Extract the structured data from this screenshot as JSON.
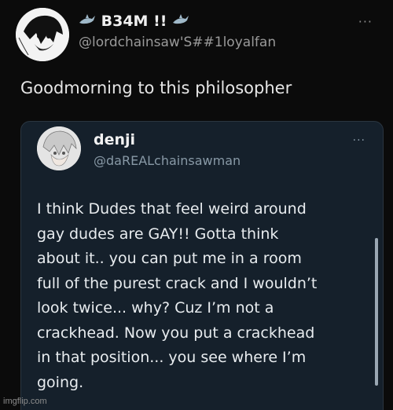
{
  "tweet": {
    "author_name": "B34M !!",
    "author_handle": "@lordchainsaw'S##1loyalfan",
    "more_label": "···",
    "text": "Goodmorning to this philosopher"
  },
  "quoted": {
    "author_name": "denji",
    "author_handle": "@daREALchainsawman",
    "more_label": "···",
    "lines": [
      "I think Dudes that feel weird around",
      "gay dudes are GAY!! Gotta think",
      "about it.. you can put me  in a room",
      "full of the purest crack and I wouldn’t",
      "look twice... why? Cuz I’m not a",
      "crackhead. Now you put a crackhead",
      "in that position... you see where I’m",
      "going."
    ]
  },
  "watermark": "imgflip.com",
  "colors": {
    "background": "#0b0b0b",
    "card_background": "#15202b",
    "secondary_text": "#8899a6"
  }
}
